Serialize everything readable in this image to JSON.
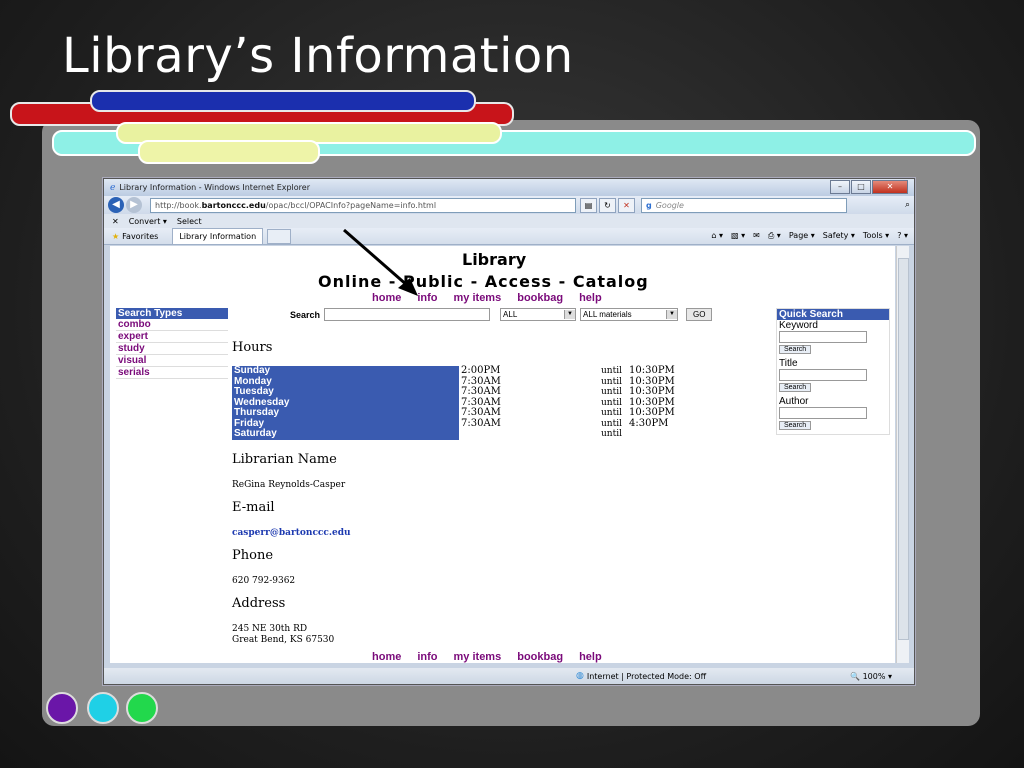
{
  "slide": {
    "title": "Library’s Information"
  },
  "browser": {
    "window_title": "Library Information - Windows Internet Explorer",
    "url_prefix": "http://book.",
    "url_domain": "bartonccc.edu",
    "url_path": "/opac/bccl/OPACInfo?pageName=info.html",
    "search_provider": "Google",
    "cmd_convert": "Convert",
    "cmd_select": "Select",
    "favorites": "Favorites",
    "tab_label": "Library Information",
    "toolbar_page": "Page ▾",
    "toolbar_safety": "Safety ▾",
    "toolbar_tools": "Tools ▾",
    "status_zone": "Internet | Protected Mode: Off",
    "status_zoom": "100%"
  },
  "catalog": {
    "title": "Library",
    "subtitle": "Online - Public - Access - Catalog",
    "nav": [
      "home",
      "info",
      "my items",
      "bookbag",
      "help"
    ],
    "search_types_header": "Search Types",
    "search_types": [
      "combo",
      "expert",
      "study",
      "visual",
      "serials"
    ],
    "search_label": "Search",
    "scope_select": "ALL",
    "materials_select": "ALL materials",
    "go_label": "GO",
    "quick_search_header": "Quick Search",
    "quick_fields": [
      {
        "label": "Keyword",
        "button": "Search"
      },
      {
        "label": "Title",
        "button": "Search"
      },
      {
        "label": "Author",
        "button": "Search"
      }
    ]
  },
  "info": {
    "hours_heading": "Hours",
    "hours": [
      {
        "day": "Sunday",
        "open": "2:00PM",
        "until": "until",
        "close": "10:30PM"
      },
      {
        "day": "Monday",
        "open": "7:30AM",
        "until": "until",
        "close": "10:30PM"
      },
      {
        "day": "Tuesday",
        "open": "7:30AM",
        "until": "until",
        "close": "10:30PM"
      },
      {
        "day": "Wednesday",
        "open": "7:30AM",
        "until": "until",
        "close": "10:30PM"
      },
      {
        "day": "Thursday",
        "open": "7:30AM",
        "until": "until",
        "close": "10:30PM"
      },
      {
        "day": "Friday",
        "open": "7:30AM",
        "until": "until",
        "close": "4:30PM"
      },
      {
        "day": "Saturday",
        "open": "",
        "until": "until",
        "close": ""
      }
    ],
    "librarian_heading": "Librarian Name",
    "librarian": "ReGina Reynolds-Casper",
    "email_heading": "E-mail",
    "email": "casperr@bartonccc.edu",
    "phone_heading": "Phone",
    "phone": "620 792-9362",
    "address_heading": "Address",
    "address_line1": "245 NE 30th RD",
    "address_line2": "Great Bend, KS 67530"
  },
  "colors": {
    "accent_blue": "#3a5bb0",
    "link_purple": "#7a0a7a"
  }
}
